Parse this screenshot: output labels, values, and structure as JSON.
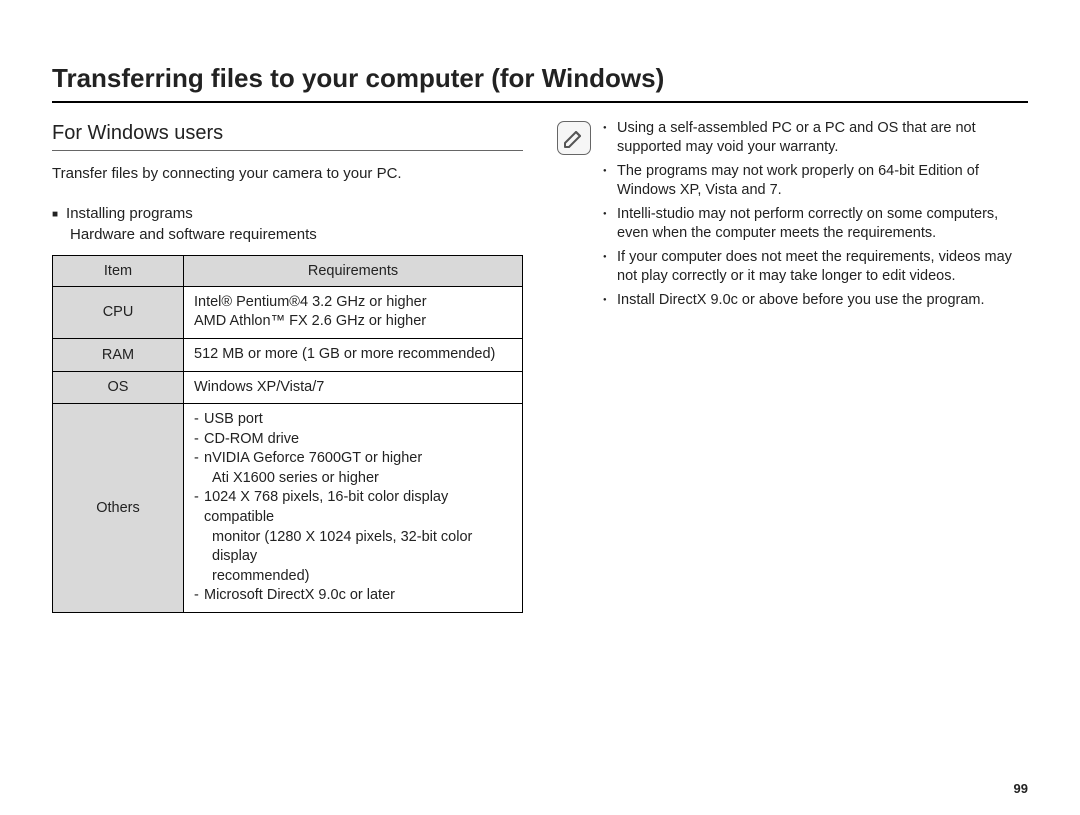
{
  "title": "Transferring files to your computer (for Windows)",
  "left": {
    "heading": "For Windows users",
    "intro": "Transfer files by connecting your camera to your PC.",
    "install_heading": "Installing programs",
    "install_sub": "Hardware and software requirements",
    "table": {
      "header_item": "Item",
      "header_req": "Requirements",
      "rows": [
        {
          "item": "CPU",
          "req_lines": [
            "Intel® Pentium®4 3.2 GHz or higher",
            "AMD Athlon™ FX 2.6 GHz or higher"
          ]
        },
        {
          "item": "RAM",
          "req_lines": [
            "512 MB or more (1 GB or more recommended)"
          ]
        },
        {
          "item": "OS",
          "req_lines": [
            "Windows XP/Vista/7"
          ]
        }
      ],
      "others": {
        "item": "Others",
        "lines": [
          "USB port",
          "CD-ROM drive",
          "nVIDIA Geforce 7600GT or higher",
          "Ati X1600 series or higher",
          "1024 X 768 pixels, 16-bit color display compatible",
          "monitor (1280 X 1024 pixels, 32-bit color display",
          "recommended)",
          "Microsoft DirectX 9.0c or later"
        ]
      }
    }
  },
  "right": {
    "notes": [
      "Using a self-assembled  PC or a PC and OS that are not supported may void your warranty.",
      "The programs may not work properly on 64-bit Edition of Windows XP, Vista and 7.",
      "Intelli-studio may not perform correctly on some computers, even when the computer meets the requirements.",
      "If your computer does not meet the requirements, videos may not play correctly or it may take longer to edit videos.",
      "Install DirectX 9.0c or above before you use the program."
    ]
  },
  "page_number": "99"
}
